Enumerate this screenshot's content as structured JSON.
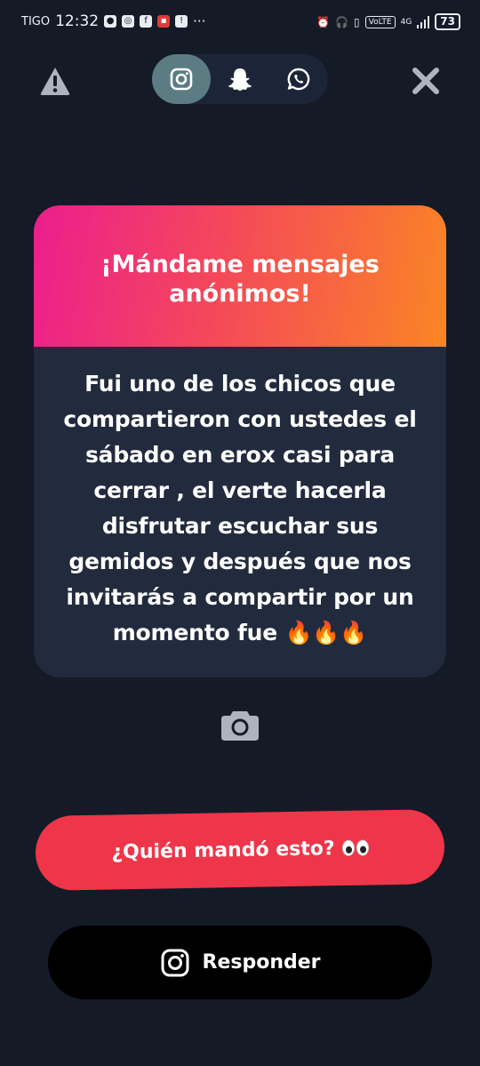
{
  "status_bar": {
    "carrier": "TIGO",
    "time": "12:32",
    "network_badge": "VoLTE",
    "network_type": "4G",
    "battery": "73"
  },
  "platform_tabs": [
    {
      "icon": "instagram-icon",
      "active": true
    },
    {
      "icon": "snapchat-icon",
      "active": false
    },
    {
      "icon": "whatsapp-icon",
      "active": false
    }
  ],
  "card": {
    "title": "¡Mándame mensajes anónimos!",
    "message": "Fui uno de los chicos que compartieron con ustedes el sábado en erox casi para cerrar , el verte hacerla disfrutar escuchar sus gemidos y después que nos invitarás a compartir por un momento fue 🔥🔥🔥"
  },
  "buttons": {
    "who_sent": "¿Quién mandó esto?",
    "reply": "Responder"
  },
  "colors": {
    "background": "#151a27",
    "card_body": "#222b3d",
    "gradient_start": "#ec1e8e",
    "gradient_end": "#fa8624",
    "who_button": "#ef3549",
    "reply_button": "#000000",
    "active_tab": "#5c7c84"
  }
}
